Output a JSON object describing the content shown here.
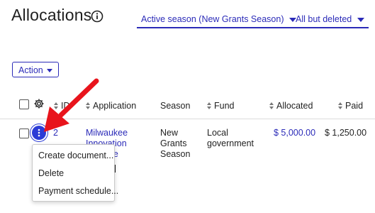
{
  "page": {
    "title": "Allocations"
  },
  "filters": {
    "season": "Active season (New Grants Season)",
    "status": "All but deleted"
  },
  "toolbar": {
    "action_label": "Action"
  },
  "table": {
    "columns": {
      "id": "ID",
      "application": "Application",
      "season": "Season",
      "fund": "Fund",
      "allocated": "Allocated",
      "paid": "Paid"
    },
    "row": {
      "id": "2",
      "application_line1": "Milwaukee",
      "application_line2": "Innovation",
      "application_line3": "Initiative",
      "season_line1": "New",
      "season_line2": "Grants",
      "season_line3": "Season",
      "fund_line1": "Local",
      "fund_line2": "government",
      "allocated": "$ 5,000.00",
      "paid": "$ 1,250.00"
    }
  },
  "row_menu": {
    "items": [
      "Create document...",
      "Delete",
      "Payment schedule..."
    ]
  },
  "colors": {
    "accent": "#2b2bb8",
    "kebab": "#2b3bd6",
    "annotation_arrow": "#e8141c"
  }
}
